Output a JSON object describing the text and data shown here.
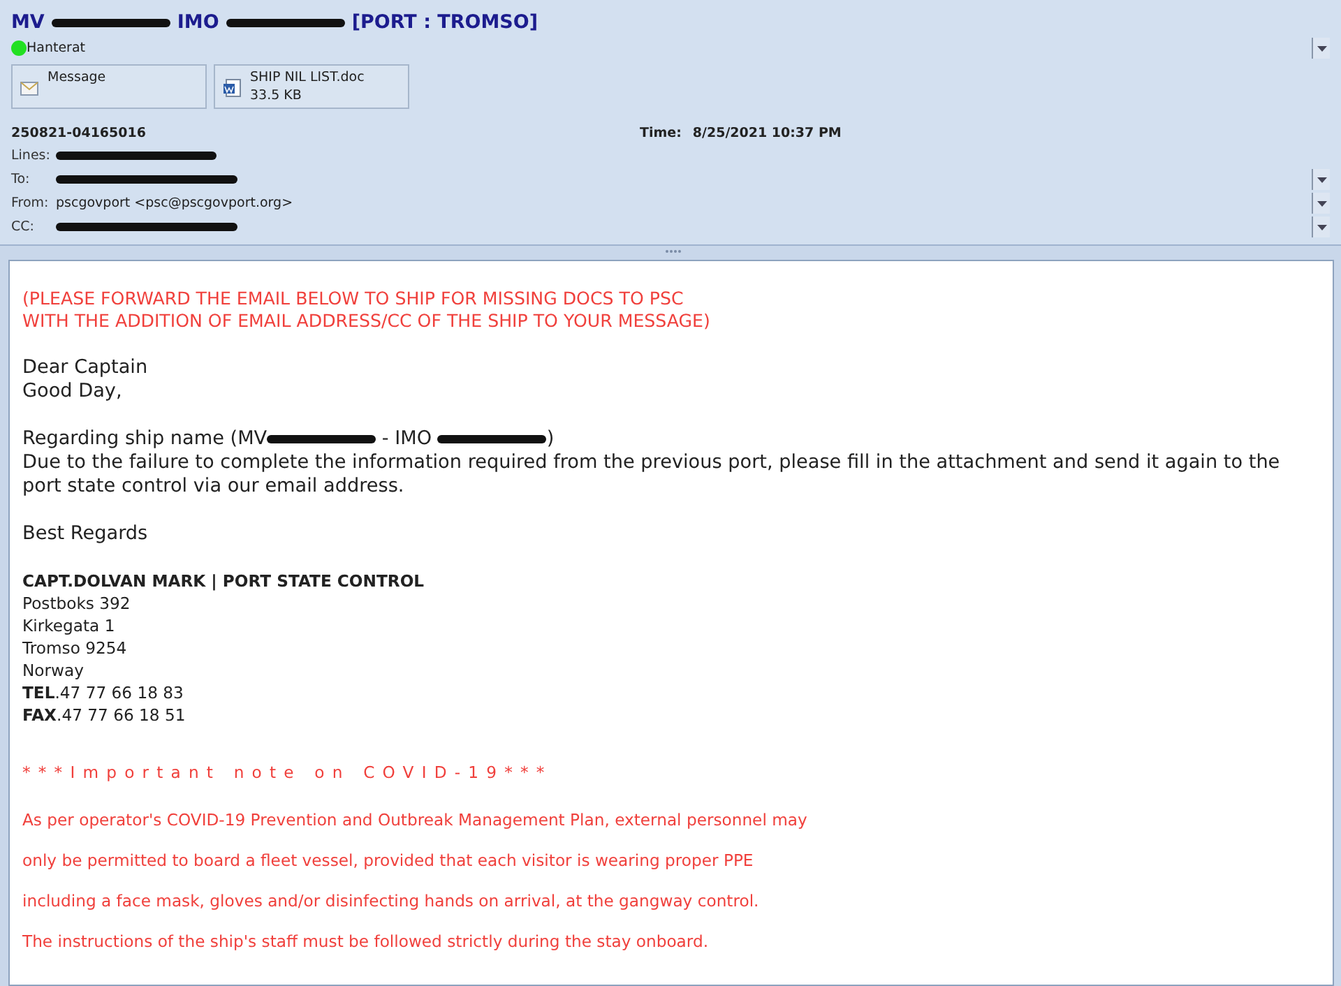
{
  "message": {
    "subject_parts": [
      {
        "kind": "text",
        "text": "MV"
      },
      {
        "kind": "redacted"
      },
      {
        "kind": "text",
        "text": "IMO"
      },
      {
        "kind": "redacted"
      },
      {
        "kind": "text",
        "text": "[PORT : TROMSO]"
      }
    ],
    "status": {
      "label": "Hanterat",
      "color": "#22e022"
    },
    "attachments": [
      {
        "kind": "message",
        "name": "Message"
      },
      {
        "kind": "document",
        "name": "SHIP  NIL LIST.doc",
        "size": "33.5 KB"
      }
    ],
    "id": "250821-04165016",
    "time_label": "Time:",
    "time": "8/25/2021 10:37 PM",
    "fields": [
      {
        "label": "Lines:",
        "redacted": true,
        "expandable": false
      },
      {
        "label": "To:",
        "redacted": true,
        "expandable": true
      },
      {
        "label": "From:",
        "redacted": false,
        "value": "pscgovport <psc@pscgovport.org>",
        "expandable": true
      },
      {
        "label": "CC:",
        "redacted": true,
        "expandable": true
      }
    ]
  },
  "body": [
    {
      "kind": "notice",
      "lines": [
        "(PLEASE FORWARD THE EMAIL BELOW TO SHIP FOR MISSING DOCS TO PSC",
        "WITH THE ADDITION OF EMAIL ADDRESS/CC OF THE SHIP TO YOUR MESSAGE)"
      ]
    },
    {
      "kind": "text",
      "lines": [
        "Dear Captain",
        "Good Day,"
      ]
    },
    {
      "kind": "text",
      "lines": [
        {
          "parts": [
            {
              "kind": "text",
              "text": "Regarding ship name (MV"
            },
            {
              "kind": "redacted"
            },
            {
              "kind": "text",
              "text": " - IMO "
            },
            {
              "kind": "redacted"
            },
            {
              "kind": "text",
              "text": ")"
            }
          ]
        },
        "Due to the failure to complete the information required from the previous port, please fill in the attachment and send it again to the port state control via our email address."
      ]
    },
    {
      "kind": "text",
      "lines": [
        "Best Regards"
      ]
    },
    {
      "kind": "signature",
      "name": "CAPT.DOLVAN MARK | PORT STATE CONTROL",
      "lines": [
        "Postboks 392",
        "Kirkegata 1",
        "Tromso 9254",
        "Norway",
        "**TEL**.47 77 66 18 83",
        "**FAX**.47 77 66 18 51"
      ]
    },
    {
      "kind": "covid",
      "heading": "***Important note on COVID-19***",
      "lines": [
        "As per operator's COVID-19 Prevention and Outbreak Management Plan, external personnel may",
        "only be permitted to board a fleet vessel, provided that each visitor is wearing proper PPE",
        "including a face mask, gloves and/or disinfecting hands on arrival, at the gangway control.",
        "The instructions of the ship's staff must be followed strictly during the stay onboard."
      ]
    }
  ]
}
